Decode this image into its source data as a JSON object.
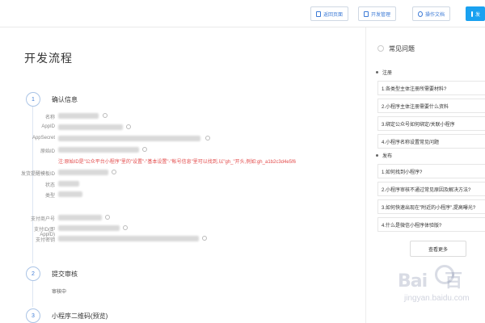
{
  "toolbar": {
    "buttons": [
      {
        "label": "返回页面"
      },
      {
        "label": "开发管理"
      },
      {
        "label": "操作文档"
      },
      {
        "label": "发"
      }
    ]
  },
  "main": {
    "title": "开发流程",
    "steps": [
      {
        "number": "1",
        "title": "确认信息"
      },
      {
        "number": "2",
        "title": "提交审核",
        "status": "审核中"
      },
      {
        "number": "3",
        "title": "小程序二维码(预览)"
      }
    ],
    "fields": [
      {
        "label": "名称"
      },
      {
        "label": "AppID"
      },
      {
        "label": "AppSecret"
      },
      {
        "label": "原始ID"
      },
      {
        "label": "发货提醒模板ID"
      },
      {
        "label": "状态"
      },
      {
        "label": "类型"
      }
    ],
    "warning": "注:原始ID是\"公众平台小程序\"里的\"设置\"-\"基本设置\"-\"帐号信息\"里可以找到,以\"gh_\"开头,例如:gh_a1b2c3d4e5f6",
    "pay_fields": [
      {
        "label": "支付商户号"
      },
      {
        "label": "支付ID(即AppID)"
      },
      {
        "label": "支付密钥"
      }
    ]
  },
  "side": {
    "title": "常见问题",
    "categories": [
      {
        "name": "注册",
        "items": [
          "1.各类型主体注册所需要材料?",
          "2.小程序主体注册需要什么资料",
          "3.绑定公众号如何绑定/关联小程序",
          "4.小程序名称设置常见问题"
        ]
      },
      {
        "name": "发布",
        "items": [
          "1.如何找到小程序?",
          "2.小程序审核不通过常见原因及解决方法?",
          "3.如何快速出现在\"附近的小程序\",提高曝光?",
          "4.什么是微信小程序体验版?"
        ]
      }
    ],
    "more_label": "查看更多"
  },
  "watermark": {
    "brand": "Bai",
    "brand_end": "百",
    "sub": "jingyan.baidu.com"
  },
  "colors": {
    "accent": "#3d7bd6",
    "primary": "#1aa1f0",
    "warning": "#e34b4b"
  }
}
